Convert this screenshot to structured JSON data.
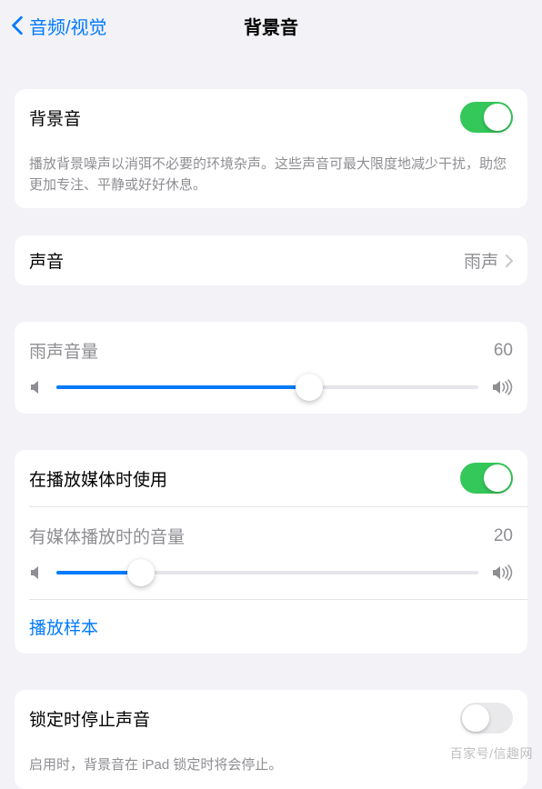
{
  "nav": {
    "back_label": "音频/视觉",
    "title": "背景音"
  },
  "main_toggle": {
    "label": "背景音",
    "on": true,
    "description": "播放背景噪声以消弭不必要的环境杂声。这些声音可最大限度地减少干扰，助您更加专注、平静或好好休息。"
  },
  "sound_row": {
    "label": "声音",
    "value": "雨声"
  },
  "volume1": {
    "label": "雨声音量",
    "value": 60
  },
  "media": {
    "toggle_label": "在播放媒体时使用",
    "toggle_on": true,
    "volume_label": "有媒体播放时的音量",
    "volume_value": 20,
    "play_sample_label": "播放样本"
  },
  "lock": {
    "label": "锁定时停止声音",
    "on": false,
    "description": "启用时，背景音在 iPad 锁定时将会停止。"
  },
  "watermark": "百家号/信趣网"
}
